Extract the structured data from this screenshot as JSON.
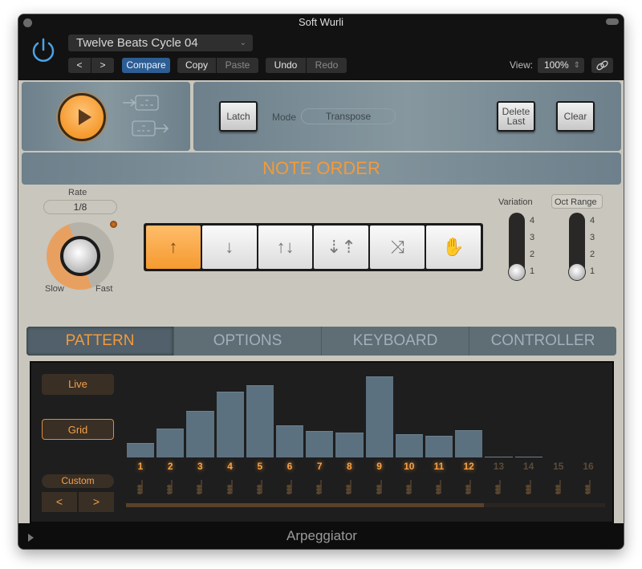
{
  "window": {
    "title": "Soft Wurli"
  },
  "header": {
    "preset": "Twelve Beats Cycle 04",
    "prev_label": "<",
    "next_label": ">",
    "compare_label": "Compare",
    "copy_label": "Copy",
    "paste_label": "Paste",
    "undo_label": "Undo",
    "redo_label": "Redo",
    "view_label": "View:",
    "view_value": "100%"
  },
  "transport": {
    "latch_label": "Latch",
    "mode_label": "Mode",
    "mode_value": "Transpose",
    "delete_last_line1": "Delete",
    "delete_last_line2": "Last",
    "clear_label": "Clear"
  },
  "note_order": {
    "title": "NOTE ORDER",
    "rate_label": "Rate",
    "rate_value": "1/8",
    "slow_label": "Slow",
    "fast_label": "Fast",
    "buttons": [
      {
        "name": "up",
        "glyph": "↑",
        "active": true
      },
      {
        "name": "down",
        "glyph": "↓",
        "active": false
      },
      {
        "name": "up-down",
        "glyph": "↑↓",
        "active": false
      },
      {
        "name": "outside-in",
        "glyph": "⇣⇡",
        "active": false
      },
      {
        "name": "random",
        "glyph": "⤨",
        "active": false
      },
      {
        "name": "as-played",
        "glyph": "✋",
        "active": false
      }
    ],
    "variation_label": "Variation",
    "variation_value": 1,
    "oct_range_label": "Oct Range",
    "oct_range_value": 1,
    "scale": [
      "4",
      "3",
      "2",
      "1"
    ]
  },
  "tabs": [
    {
      "label": "PATTERN",
      "active": true
    },
    {
      "label": "OPTIONS",
      "active": false
    },
    {
      "label": "KEYBOARD",
      "active": false
    },
    {
      "label": "CONTROLLER",
      "active": false
    }
  ],
  "pattern": {
    "live_label": "Live",
    "grid_label": "Grid",
    "grid_selected": true,
    "custom_label": "Custom",
    "prev_label": "<",
    "next_label": ">",
    "active_steps": 12,
    "steps": [
      {
        "n": "1",
        "level": 0.16
      },
      {
        "n": "2",
        "level": 0.33
      },
      {
        "n": "3",
        "level": 0.53
      },
      {
        "n": "4",
        "level": 0.75
      },
      {
        "n": "5",
        "level": 0.82
      },
      {
        "n": "6",
        "level": 0.36
      },
      {
        "n": "7",
        "level": 0.3
      },
      {
        "n": "8",
        "level": 0.28
      },
      {
        "n": "9",
        "level": 0.92
      },
      {
        "n": "10",
        "level": 0.26
      },
      {
        "n": "11",
        "level": 0.25
      },
      {
        "n": "12",
        "level": 0.31
      },
      {
        "n": "13",
        "level": 0.01
      },
      {
        "n": "14",
        "level": 0.01
      },
      {
        "n": "15",
        "level": 0
      },
      {
        "n": "16",
        "level": 0
      }
    ]
  },
  "footer": {
    "title": "Arpeggiator"
  },
  "colors": {
    "accent": "#f39a3a",
    "bar": "#5c7180",
    "compare": "#2d5d93"
  }
}
